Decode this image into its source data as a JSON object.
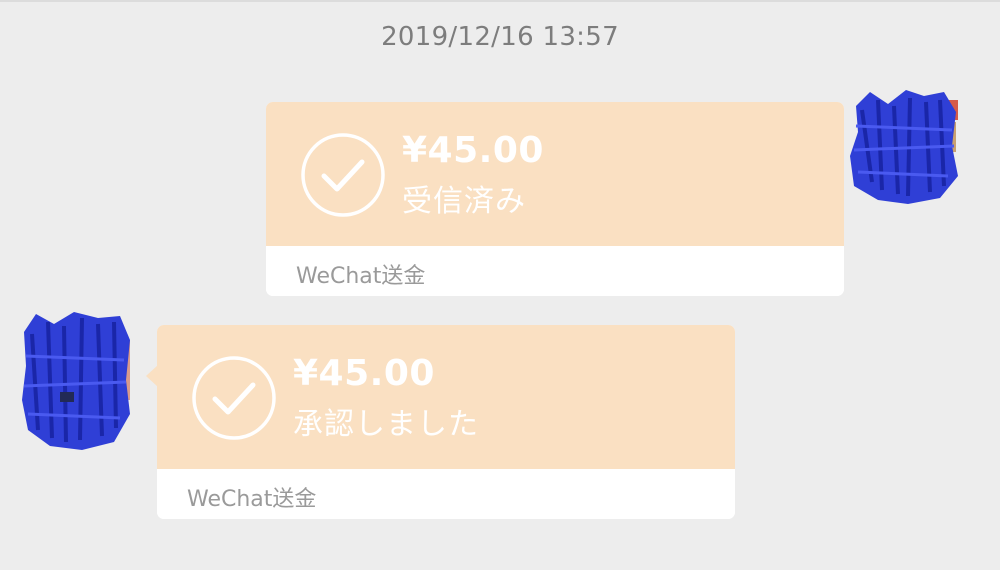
{
  "chat": {
    "timestamp": "2019/12/16 13:57",
    "messages": [
      {
        "side": "right",
        "amount": "¥45.00",
        "status": "受信済み",
        "brand": "WeChat送金"
      },
      {
        "side": "left",
        "amount": "¥45.00",
        "status": "承認しました",
        "brand": "WeChat送金"
      }
    ]
  },
  "colors": {
    "background": "#ededed",
    "card_accent": "#fae0c2",
    "avatar_scribble": "#2f3fd6",
    "text_muted": "#7d7d7d"
  },
  "icons": {
    "transfer_status": "check-circle-icon"
  }
}
